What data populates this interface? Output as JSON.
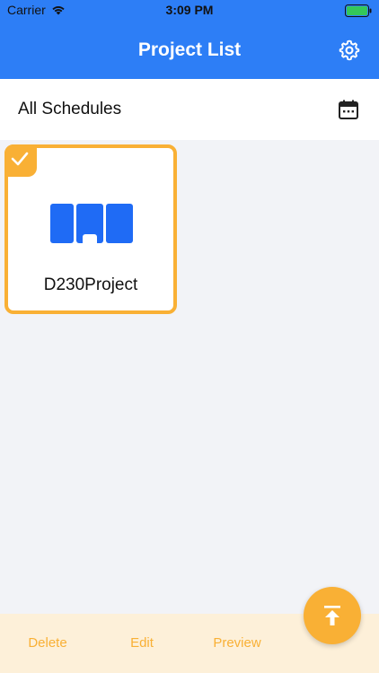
{
  "statusbar": {
    "carrier": "Carrier",
    "time": "3:09 PM"
  },
  "navbar": {
    "title": "Project List"
  },
  "schedule": {
    "label": "All Schedules"
  },
  "projects": [
    {
      "name": "D230Project",
      "selected": true
    }
  ],
  "bottombar": {
    "delete_label": "Delete",
    "edit_label": "Edit",
    "preview_label": "Preview"
  },
  "colors": {
    "primary": "#2d7ef6",
    "accent": "#f9b035",
    "bottombar_bg": "#fdf0d9",
    "background": "#f2f3f7"
  }
}
